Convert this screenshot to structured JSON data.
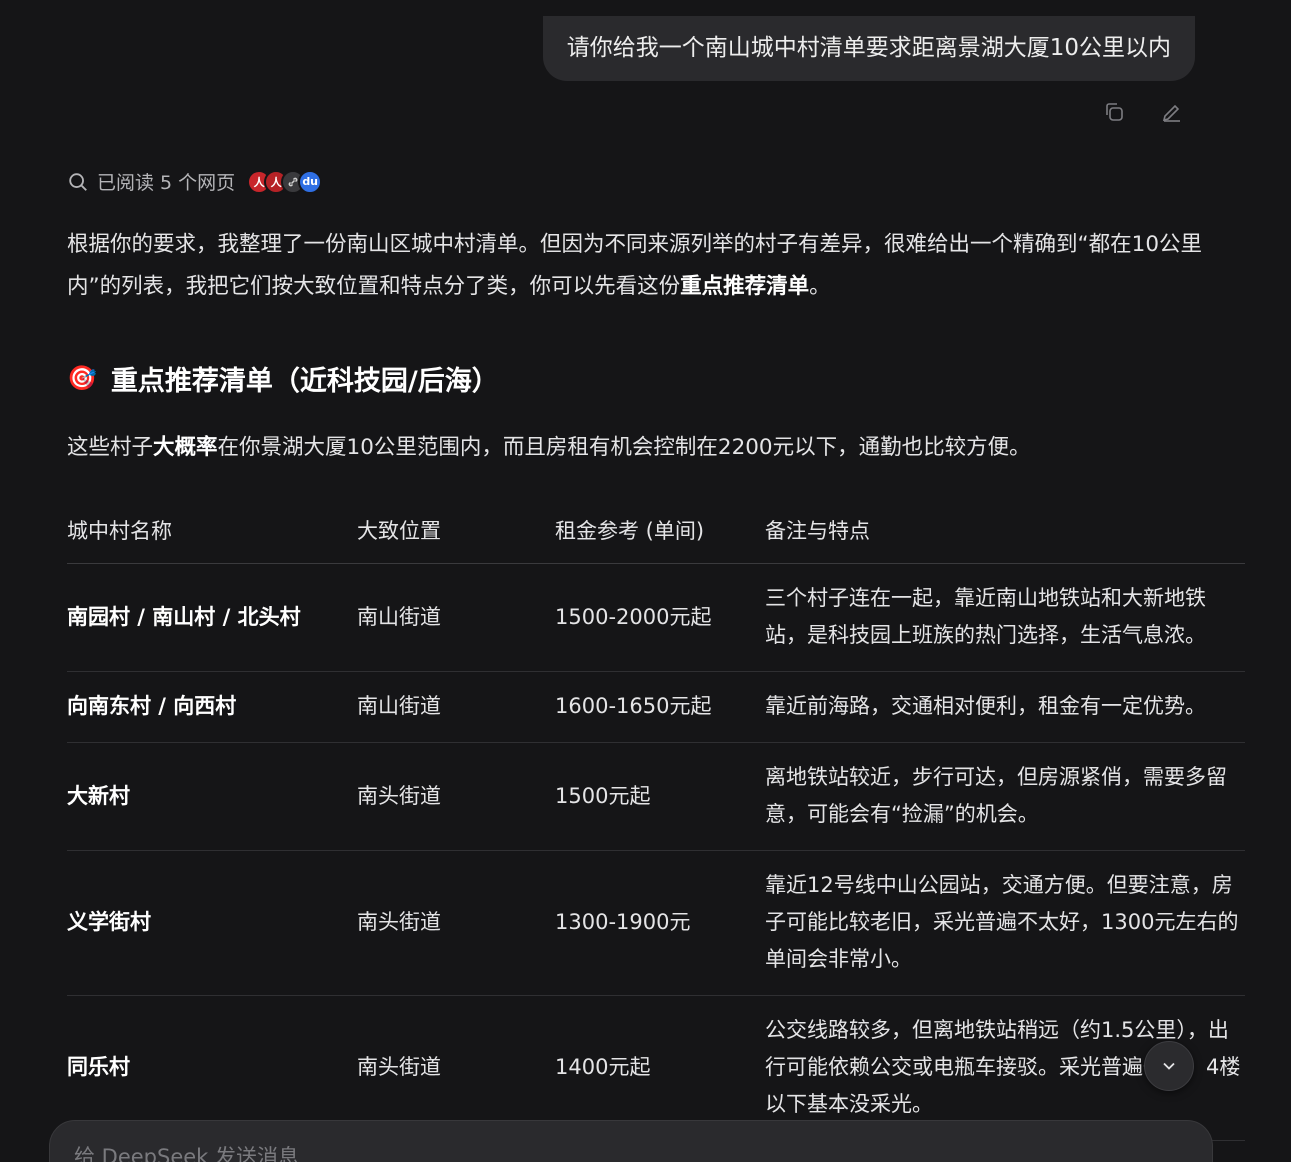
{
  "user_message": {
    "text": "请你给我一个南山城中村清单要求距离景湖大厦10公里以内"
  },
  "message_actions": {
    "copy_icon": "copy-icon",
    "edit_icon": "edit-icon"
  },
  "search": {
    "label": "已阅读 5 个网页",
    "favicons": [
      "red-seal",
      "red-seal",
      "link",
      "baidu"
    ]
  },
  "intro": {
    "text": "根据你的要求，我整理了一份南山区城中村清单。但因为不同来源列举的村子有差异，很难给出一个精确到“都在10公里内”的列表，我把它们按大致位置和特点分了类，你可以先看这份",
    "bold": "重点推荐清单",
    "end": "。"
  },
  "section": {
    "emoji": "🎯",
    "title": "重点推荐清单（近科技园/后海）",
    "desc_prefix": "这些村子",
    "desc_bold": "大概率",
    "desc_suffix": "在你景湖大厦10公里范围内，而且房租有机会控制在2200元以下，通勤也比较方便。"
  },
  "table": {
    "headers": [
      "城中村名称",
      "大致位置",
      "租金参考 (单间)",
      "备注与特点"
    ],
    "rows": [
      {
        "name": "南园村 / 南山村 / 北头村",
        "location": "南山街道",
        "rent": "1500-2000元起",
        "note": "三个村子连在一起，靠近南山地铁站和大新地铁站，是科技园上班族的热门选择，生活气息浓。"
      },
      {
        "name": "向南东村 / 向西村",
        "location": "南山街道",
        "rent": "1600-1650元起",
        "note": "靠近前海路，交通相对便利，租金有一定优势。"
      },
      {
        "name": "大新村",
        "location": "南头街道",
        "rent": "1500元起",
        "note": "离地铁站较近，步行可达，但房源紧俏，需要多留意，可能会有“捡漏”的机会。"
      },
      {
        "name": "义学街村",
        "location": "南头街道",
        "rent": "1300-1900元",
        "note": "靠近12号线中山公园站，交通方便。但要注意，房子可能比较老旧，采光普遍不太好，1300元左右的单间会非常小。"
      },
      {
        "name": "同乐村",
        "location": "南头街道",
        "rent": "1400元起",
        "note": "公交线路较多，但离地铁站稍远（约1.5公里），出行可能依赖公交或电瓶车接驳。采光普遍一般，4楼以下基本没采光。"
      }
    ]
  },
  "input": {
    "placeholder": "给 DeepSeek 发送消息"
  },
  "colors": {
    "background": "#151517",
    "bubble": "#2a2a2d",
    "text": "#e4e4e6"
  }
}
